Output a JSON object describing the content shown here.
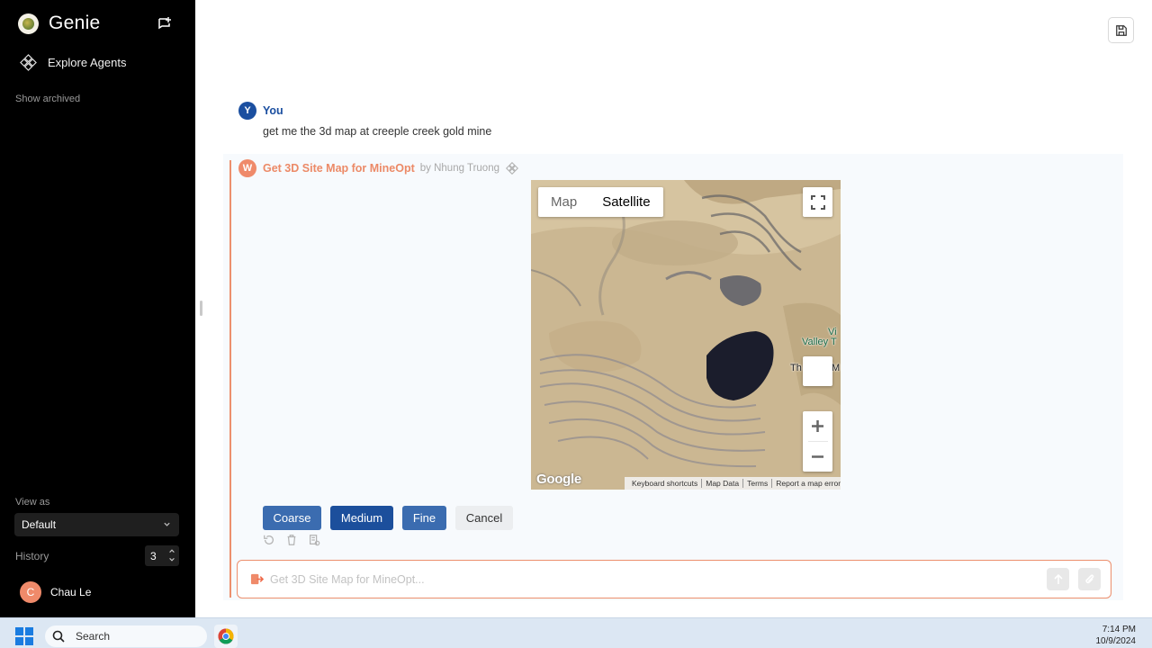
{
  "sidebar": {
    "brand": "Genie",
    "explore_label": "Explore Agents",
    "show_archived": "Show archived",
    "view_as_label": "View as",
    "view_as_value": "Default",
    "history_label": "History",
    "history_value": "3",
    "user_initial": "C",
    "user_name": "Chau Le"
  },
  "chat": {
    "user_badge": "Y",
    "user_name": "You",
    "user_message": "get me the 3d map at creeple creek gold mine",
    "agent_badge": "W",
    "agent_title": "Get 3D Site Map for MineOpt",
    "agent_by": "by Nhung Truong"
  },
  "map": {
    "tab_map": "Map",
    "tab_satellite": "Satellite",
    "selected_tab": "Satellite",
    "label_vi": "Vi",
    "label_valley": "Valley T",
    "label_th": "Th",
    "label_m": "M",
    "google": "Google",
    "footer": [
      "Keyboard shortcuts",
      "Map Data",
      "Terms",
      "Report a map error"
    ]
  },
  "actions": {
    "coarse": "Coarse",
    "medium": "Medium",
    "fine": "Fine",
    "cancel": "Cancel"
  },
  "input": {
    "placeholder": "Get 3D Site Map for MineOpt..."
  },
  "taskbar": {
    "search": "Search",
    "time": "7:14 PM",
    "date": "10/9/2024"
  },
  "colors": {
    "accent_orange": "#ec8f6d",
    "button_blue": "#3b6cb0",
    "button_active": "#1c4f9c",
    "user_blue": "#1b4fa0"
  }
}
